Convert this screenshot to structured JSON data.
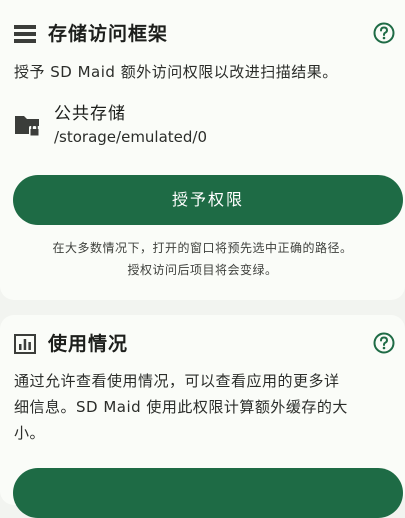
{
  "storage_card": {
    "title": "存储访问框架",
    "description": "授予 SD Maid 额外访问权限以改进扫描结果。",
    "storage_name": "公共存储",
    "storage_path": "/storage/emulated/0",
    "grant_button": "授予权限",
    "hint_line1": "在大多数情况下，打开的窗口将预先选中正确的路径。",
    "hint_line2": "授权访问后项目将会变绿。",
    "icons": {
      "header": "list-icon",
      "help": "help-icon",
      "folder": "folder-lock-icon"
    }
  },
  "usage_card": {
    "title": "使用情况",
    "description_line1": "通过允许查看使用情况，可以查看应用的更多详",
    "description_line2": "细信息。SD Maid 使用此权限计算额外缓存的大",
    "description_line3": "小。",
    "icons": {
      "header": "bar-chart-icon",
      "help": "help-icon"
    }
  },
  "colors": {
    "accent": "#1e6b45",
    "card": "#fafcf8",
    "background": "#f2f4f0"
  }
}
